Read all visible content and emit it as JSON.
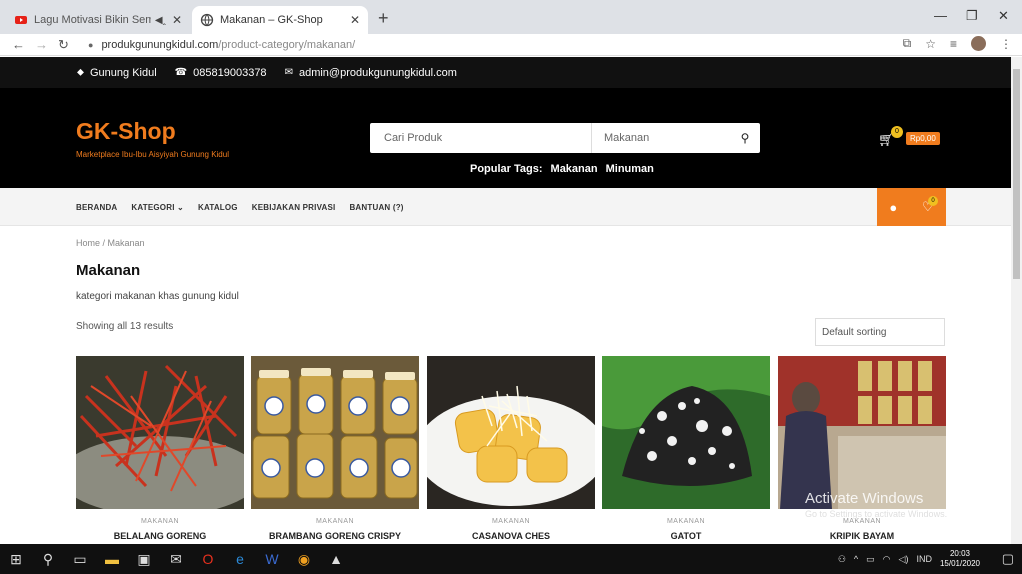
{
  "browser": {
    "tabs": [
      {
        "title": "Lagu Motivasi Bikin Semang"
      },
      {
        "title": "Makanan – GK-Shop"
      }
    ],
    "url_host": "produkgunungkidul.com",
    "url_path": "/product-category/makanan/"
  },
  "topbar": {
    "location": "Gunung Kidul",
    "phone": "085819003378",
    "email": "admin@produkgunungkidul.com"
  },
  "header": {
    "logo": "GK-Shop",
    "tagline": "Marketplace Ibu-Ibu Aisyiyah Gunung Kidul",
    "search_placeholder": "Cari Produk",
    "search_category": "Makanan",
    "popular_label": "Popular Tags:",
    "tags": [
      "Makanan",
      "Minuman"
    ],
    "cart_count": "0",
    "cart_total": "Rp0,00",
    "wishlist_count": "0"
  },
  "nav": {
    "items": [
      "BERANDA",
      "KATEGORI ⌄",
      "KATALOG",
      "KEBIJAKAN PRIVASI",
      "BANTUAN (?)"
    ]
  },
  "page": {
    "breadcrumb": "Home / Makanan",
    "title": "Makanan",
    "description": "kategori makanan khas gunung kidul",
    "results": "Showing all 13 results",
    "sorting": "Default sorting"
  },
  "products": [
    {
      "category": "MAKANAN",
      "name": "BELALANG GORENG"
    },
    {
      "category": "MAKANAN",
      "name": "BRAMBANG GORENG CRISPY"
    },
    {
      "category": "MAKANAN",
      "name": "CASANOVA CHES"
    },
    {
      "category": "MAKANAN",
      "name": "GATOT"
    },
    {
      "category": "MAKANAN",
      "name": "KRIPIK BAYAM"
    }
  ],
  "watermark": {
    "title": "Activate Windows",
    "subtitle": "Go to Settings to activate Windows."
  },
  "taskbar": {
    "lang": "IND",
    "time": "20:03",
    "date": "15/01/2020"
  },
  "colors": {
    "brand": "#f07c1e",
    "dark": "#000000"
  }
}
